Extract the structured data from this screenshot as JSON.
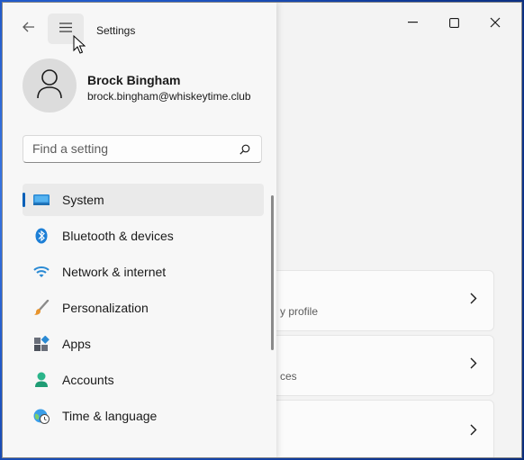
{
  "window": {
    "title": "Settings",
    "controls": {
      "minimize": "minimize-icon",
      "maximize": "maximize-icon",
      "close": "close-icon"
    }
  },
  "user": {
    "name": "Brock Bingham",
    "email": "brock.bingham@whiskeytime.club"
  },
  "search": {
    "placeholder": "Find a setting"
  },
  "nav": {
    "selected": "System",
    "items": [
      {
        "label": "System",
        "icon": "system-display-icon"
      },
      {
        "label": "Bluetooth & devices",
        "icon": "bluetooth-icon"
      },
      {
        "label": "Network & internet",
        "icon": "wifi-icon"
      },
      {
        "label": "Personalization",
        "icon": "brush-icon"
      },
      {
        "label": "Apps",
        "icon": "apps-icon"
      },
      {
        "label": "Accounts",
        "icon": "person-icon"
      },
      {
        "label": "Time & language",
        "icon": "globe-clock-icon"
      }
    ]
  },
  "content": {
    "cards": [
      {
        "subtitle": "y profile"
      },
      {
        "subtitle": "ces"
      },
      {
        "subtitle": ""
      }
    ]
  },
  "colors": {
    "accent": "#005fb8",
    "nav_bg": "#f7f7f7",
    "content_bg": "#f3f3f3"
  }
}
